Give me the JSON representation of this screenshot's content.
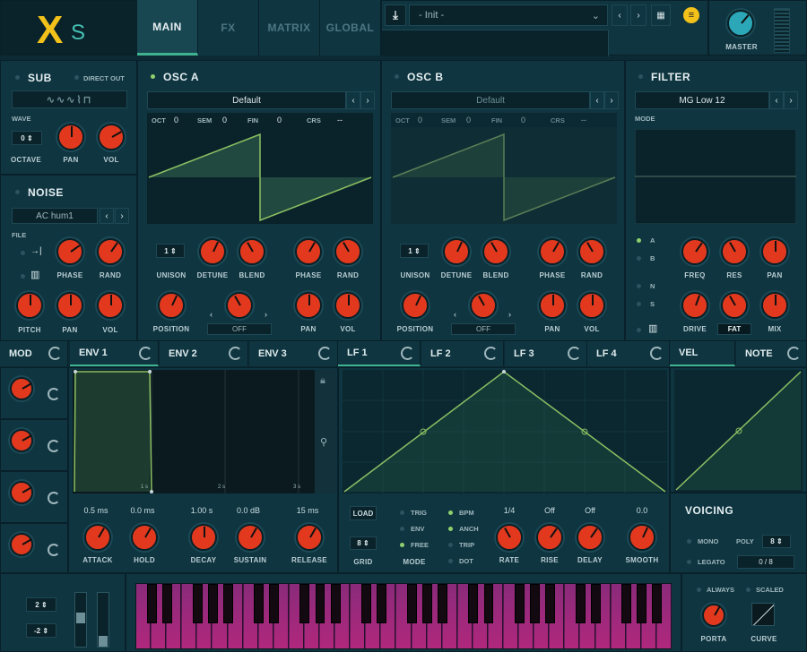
{
  "brand": {
    "logo": "X",
    "logo_s": "S"
  },
  "tabs": [
    "MAIN",
    "FX",
    "MATRIX",
    "GLOBAL"
  ],
  "preset": {
    "name": "- Init -"
  },
  "master": {
    "label": "MASTER"
  },
  "sub": {
    "title": "SUB",
    "direct_out": "DIRECT OUT",
    "wave": "WAVE",
    "octave_val": "0",
    "octave": "OCTAVE",
    "pan": "PAN",
    "vol": "VOL"
  },
  "noise": {
    "title": "NOISE",
    "preset": "AC hum1",
    "file": "FILE",
    "phase": "PHASE",
    "rand": "RAND",
    "pitch": "PITCH",
    "pan": "PAN",
    "vol": "VOL"
  },
  "osc_a": {
    "title": "OSC A",
    "wavetable": "Default",
    "oct": "OCT",
    "oct_v": "0",
    "sem": "SEM",
    "sem_v": "0",
    "fin": "FIN",
    "fin_v": "0",
    "crs": "CRS",
    "crs_v": "--",
    "unison_v": "1",
    "unison": "UNISON",
    "detune": "DETUNE",
    "blend": "BLEND",
    "phase": "PHASE",
    "rand": "RAND",
    "position": "POSITION",
    "off": "OFF",
    "pan": "PAN",
    "vol": "VOL"
  },
  "osc_b": {
    "title": "OSC B",
    "wavetable": "Default",
    "oct": "OCT",
    "oct_v": "0",
    "sem": "SEM",
    "sem_v": "0",
    "fin": "FIN",
    "fin_v": "0",
    "crs": "CRS",
    "crs_v": "--",
    "unison_v": "1",
    "unison": "UNISON",
    "detune": "DETUNE",
    "blend": "BLEND",
    "phase": "PHASE",
    "rand": "RAND",
    "position": "POSITION",
    "off": "OFF",
    "pan": "PAN",
    "vol": "VOL"
  },
  "filter": {
    "title": "FILTER",
    "type": "MG Low 12",
    "mode": "MODE",
    "a": "A",
    "b": "B",
    "n": "N",
    "s": "S",
    "freq": "FREQ",
    "res": "RES",
    "pan": "PAN",
    "drive": "DRIVE",
    "fat": "FAT",
    "mix": "MIX"
  },
  "mod_tabs": {
    "mod": "MOD",
    "env1": "ENV 1",
    "env2": "ENV 2",
    "env3": "ENV 3",
    "lf1": "LF 1",
    "lf2": "LF 2",
    "lf3": "LF 3",
    "lf4": "LF 4",
    "vel": "VEL",
    "note": "NOTE"
  },
  "env": {
    "t1": "1 s",
    "t2": "2 s",
    "t3": "3 s",
    "attack_v": "0.5 ms",
    "hold_v": "0.0 ms",
    "decay_v": "1.00 s",
    "sustain_v": "0.0 dB",
    "release_v": "15 ms",
    "attack": "ATTACK",
    "hold": "HOLD",
    "decay": "DECAY",
    "sustain": "SUSTAIN",
    "release": "RELEASE"
  },
  "lfo": {
    "load": "LOAD",
    "grid_v": "8",
    "grid": "GRID",
    "trig": "TRIG",
    "env": "ENV",
    "free": "FREE",
    "mode": "MODE",
    "bpm": "BPM",
    "anch": "ANCH",
    "trip": "TRIP",
    "dot": "DOT",
    "rate_v": "1/4",
    "rise_v": "Off",
    "delay_v": "Off",
    "smooth_v": "0.0",
    "rate": "RATE",
    "rise": "RISE",
    "delay": "DELAY",
    "smooth": "SMOOTH"
  },
  "voicing": {
    "title": "VOICING",
    "mono": "MONO",
    "poly": "POLY",
    "poly_v": "8",
    "legato": "LEGATO",
    "count": "0   /   8"
  },
  "keys": {
    "pb_up": "2",
    "pb_down": "-2"
  },
  "porta": {
    "always": "ALWAYS",
    "scaled": "SCALED",
    "porta": "PORTA",
    "curve": "CURVE"
  },
  "colors": {
    "accent": "#3fb28f",
    "knob": "#e2391e",
    "logo": "#f2c21b"
  }
}
